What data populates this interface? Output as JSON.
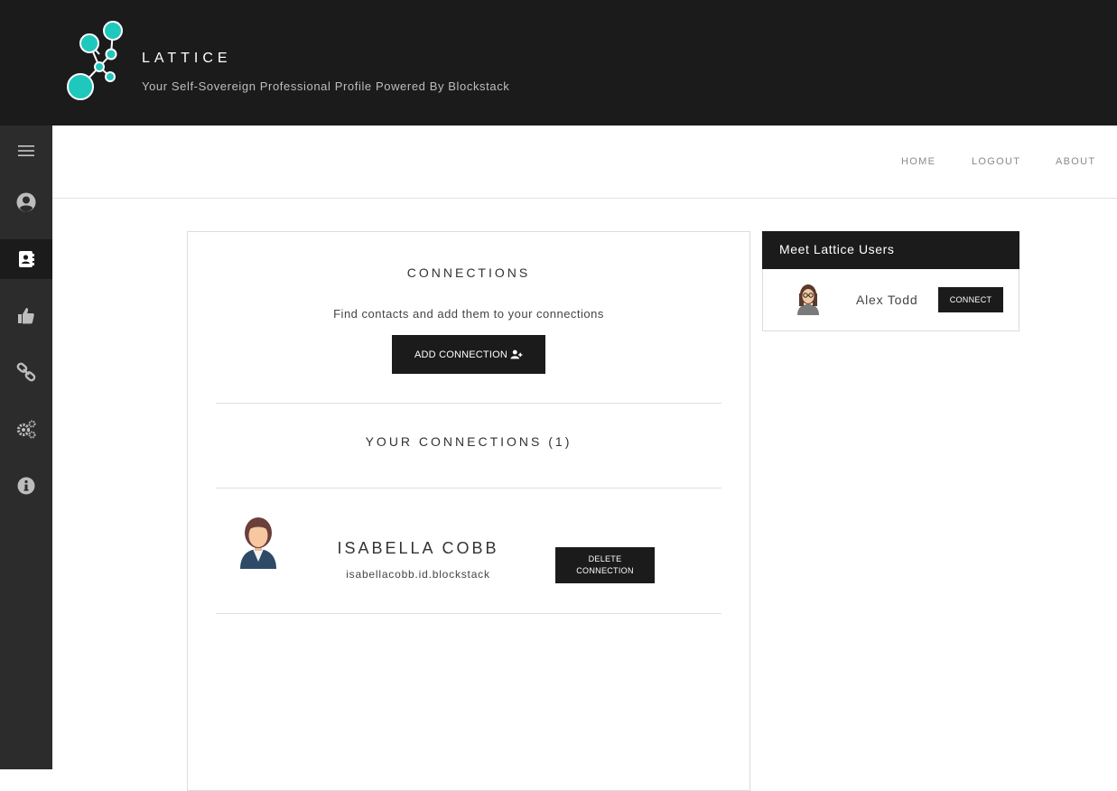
{
  "brand": {
    "title": "LATTICE",
    "tagline": "Your Self-Sovereign Professional Profile Powered By Blockstack"
  },
  "sidebar": {
    "items": [
      {
        "icon": "hamburger-menu-icon",
        "active": false
      },
      {
        "icon": "user-circle-icon",
        "active": false
      },
      {
        "icon": "address-book-icon",
        "active": true
      },
      {
        "icon": "thumbs-up-icon",
        "active": false
      },
      {
        "icon": "chain-link-icon",
        "active": false
      },
      {
        "icon": "gears-icon",
        "active": false
      },
      {
        "icon": "info-circle-icon",
        "active": false
      }
    ]
  },
  "nav": {
    "home": "HOME",
    "logout": "LOGOUT",
    "about": "ABOUT"
  },
  "connections": {
    "title": "CONNECTIONS",
    "subtitle": "Find contacts and add them to your connections",
    "add_button": "ADD CONNECTION",
    "add_button_icon": "user-plus-icon",
    "your_connections_title": "YOUR CONNECTIONS (1)",
    "list": [
      {
        "name": "ISABELLA COBB",
        "id": "isabellacobb.id.blockstack",
        "delete_line1": "DELETE",
        "delete_line2": "CONNECTION"
      }
    ]
  },
  "meet_users": {
    "title": "Meet Lattice Users",
    "users": [
      {
        "name": "Alex Todd",
        "button": "CONNECT"
      }
    ]
  },
  "colors": {
    "header_bg": "#1b1b1b",
    "sidebar_bg": "#2c2c2c",
    "accent_teal": "#1ec8bd",
    "button_bg": "#1b1b1b"
  }
}
